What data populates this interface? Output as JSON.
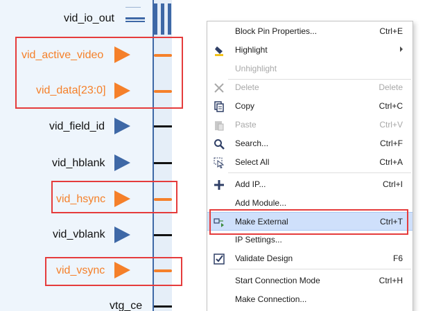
{
  "block": {
    "pins": [
      {
        "label": "vid_io_out",
        "kind": "bus"
      },
      {
        "label": "vid_active_video",
        "kind": "pin",
        "highlighted": true
      },
      {
        "label": "vid_data[23:0]",
        "kind": "pin",
        "highlighted": true
      },
      {
        "label": "vid_field_id",
        "kind": "pin",
        "highlighted": false
      },
      {
        "label": "vid_hblank",
        "kind": "pin",
        "highlighted": false
      },
      {
        "label": "vid_hsync",
        "kind": "pin",
        "highlighted": true
      },
      {
        "label": "vid_vblank",
        "kind": "pin",
        "highlighted": false
      },
      {
        "label": "vid_vsync",
        "kind": "pin",
        "highlighted": true
      },
      {
        "label": "vtg_ce",
        "kind": "pin",
        "highlighted": false
      }
    ]
  },
  "context_menu": {
    "items": [
      {
        "label": "Block Pin Properties...",
        "shortcut": "Ctrl+E",
        "icon": "none",
        "enabled": true
      },
      {
        "label": "Highlight",
        "shortcut": "",
        "icon": "highlight-icon",
        "enabled": true,
        "submenu": true
      },
      {
        "label": "Unhighlight",
        "shortcut": "",
        "icon": "none",
        "enabled": false
      },
      {
        "label": "Delete",
        "shortcut": "Delete",
        "icon": "delete-icon",
        "enabled": false
      },
      {
        "label": "Copy",
        "shortcut": "Ctrl+C",
        "icon": "copy-icon",
        "enabled": true
      },
      {
        "label": "Paste",
        "shortcut": "Ctrl+V",
        "icon": "paste-icon",
        "enabled": false
      },
      {
        "label": "Search...",
        "shortcut": "Ctrl+F",
        "icon": "search-icon",
        "enabled": true
      },
      {
        "label": "Select All",
        "shortcut": "Ctrl+A",
        "icon": "select-all-icon",
        "enabled": true
      },
      {
        "label": "Add IP...",
        "shortcut": "Ctrl+I",
        "icon": "add-icon",
        "enabled": true
      },
      {
        "label": "Add Module...",
        "shortcut": "",
        "icon": "none",
        "enabled": true
      },
      {
        "label": "Make External",
        "shortcut": "Ctrl+T",
        "icon": "make-external-icon",
        "enabled": true,
        "active": true,
        "highlighted": true
      },
      {
        "label": "IP Settings...",
        "shortcut": "",
        "icon": "none",
        "enabled": true
      },
      {
        "label": "Validate Design",
        "shortcut": "F6",
        "icon": "validate-icon",
        "enabled": true
      },
      {
        "label": "Start Connection Mode",
        "shortcut": "Ctrl+H",
        "icon": "none",
        "enabled": true
      },
      {
        "label": "Make Connection...",
        "shortcut": "",
        "icon": "none",
        "enabled": true
      }
    ]
  },
  "colors": {
    "highlight_orange": "#f5802a",
    "pin_blue": "#3e68a6",
    "annotation_red": "#e53b3b",
    "menu_active": "#cfe0fb"
  }
}
